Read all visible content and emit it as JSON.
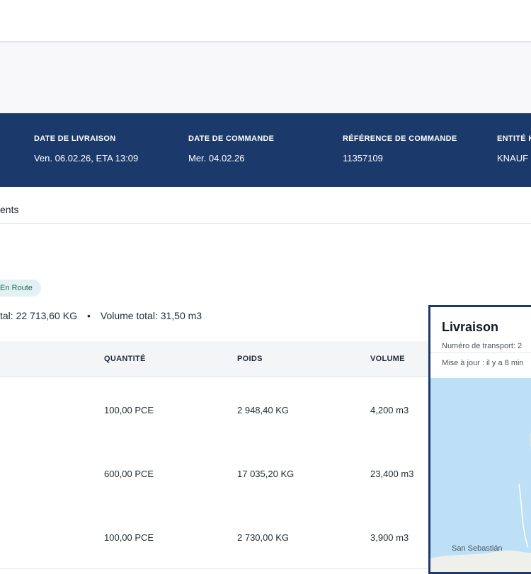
{
  "header": {
    "delivery_date": {
      "label": "DATE DE LIVRAISON",
      "value": "Ven. 06.02.26, ETA 13:09"
    },
    "order_date": {
      "label": "DATE DE COMMANDE",
      "value": "Mer. 04.02.26"
    },
    "order_ref": {
      "label": "RÉFÉRENCE DE COMMANDE",
      "value": "11357109"
    },
    "entity": {
      "label": "ENTITÉ K",
      "value": "KNAUF B"
    }
  },
  "tabs": {
    "active": "ents"
  },
  "status": {
    "label": "En Route"
  },
  "totals": {
    "weight": "tal: 22 713,60 KG",
    "separator": "•",
    "volume": "Volume total: 31,50 m3"
  },
  "table": {
    "headers": [
      "QUANTITÉ",
      "POIDS",
      "VOLUME"
    ],
    "rows": [
      [
        "100,00 PCE",
        "2 948,40 KG",
        "4,200 m3"
      ],
      [
        "600,00 PCE",
        "17 035,20 KG",
        "23,400 m3"
      ],
      [
        "100,00 PCE",
        "2 730,00 KG",
        "3,900 m3"
      ]
    ]
  },
  "map_card": {
    "title": "Livraison",
    "transport_number": "Numéro de transport: 2",
    "updated": "Mise à jour : il y a 8 min",
    "city": "San Sebastián",
    "water_color": "#bde0f6"
  },
  "colors": {
    "primary": "#1b3a6b",
    "badge_bg": "#e2f1f1",
    "badge_text": "#1c6b63"
  }
}
